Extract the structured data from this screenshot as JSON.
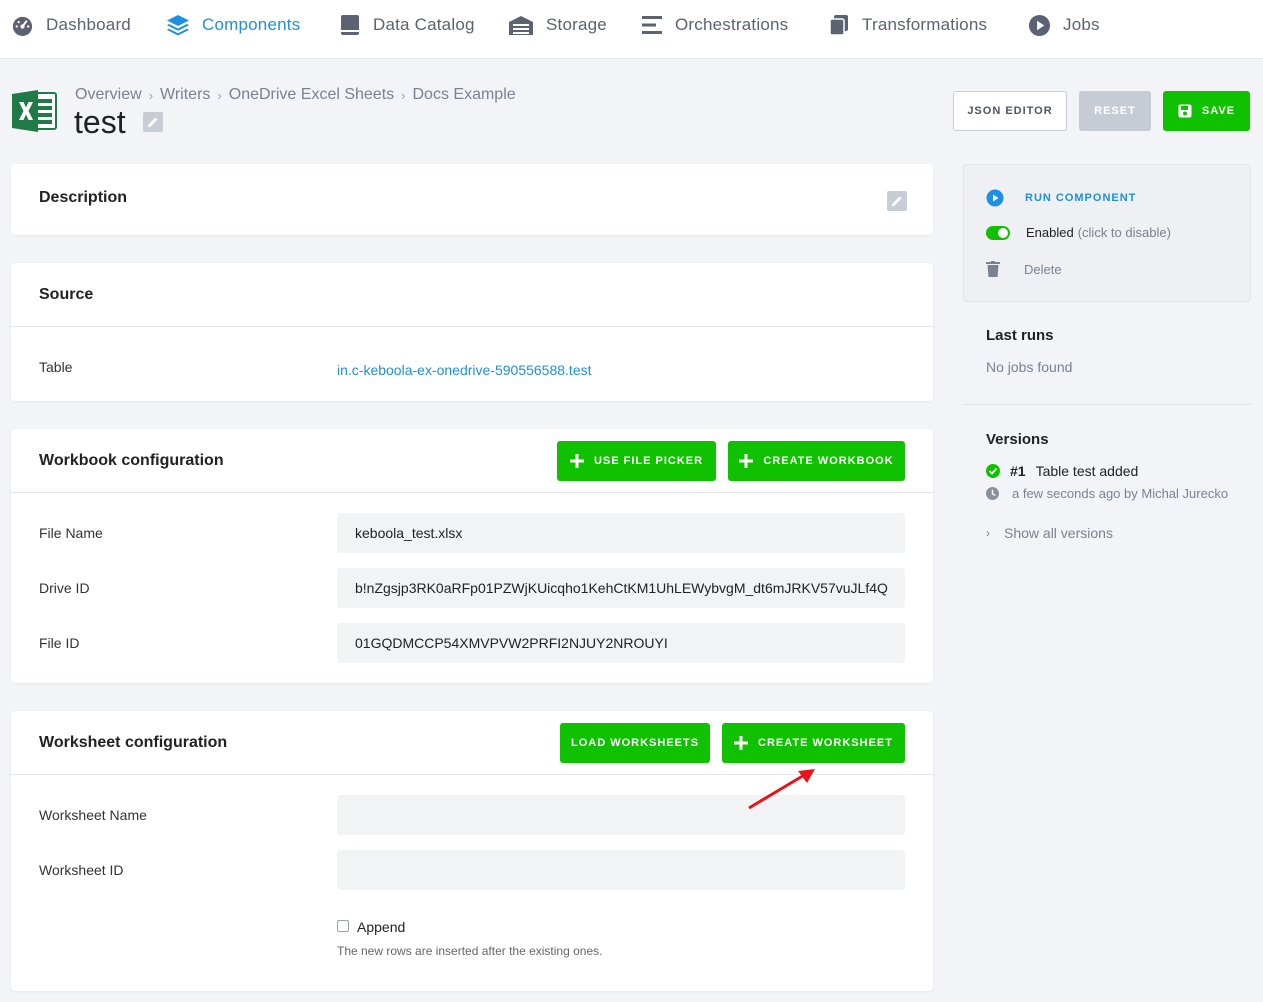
{
  "nav": {
    "dashboard": "Dashboard",
    "components": "Components",
    "data_catalog": "Data Catalog",
    "storage": "Storage",
    "orchestrations": "Orchestrations",
    "transformations": "Transformations",
    "jobs": "Jobs"
  },
  "breadcrumb": [
    "Overview",
    "Writers",
    "OneDrive Excel Sheets",
    "Docs Example"
  ],
  "page_title": "test",
  "toolbar": {
    "json_editor": "JSON EDITOR",
    "reset": "RESET",
    "save": "SAVE"
  },
  "description": {
    "title": "Description"
  },
  "source": {
    "title": "Source",
    "table_label": "Table",
    "table_value": "in.c-keboola-ex-onedrive-590556588.test"
  },
  "workbook": {
    "title": "Workbook configuration",
    "use_file_picker": "USE FILE PICKER",
    "create_workbook": "CREATE WORKBOOK",
    "file_name_label": "File Name",
    "file_name_value": "keboola_test.xlsx",
    "drive_id_label": "Drive ID",
    "drive_id_value": "b!nZgsjp3RK0aRFp01PZWjKUicqho1KehCtKM1UhLEWybvgM_dt6mJRKV57vuJLf4Q",
    "file_id_label": "File ID",
    "file_id_value": "01GQDMCCP54XMVPVW2PRFI2NJUY2NROUYI"
  },
  "worksheet": {
    "title": "Worksheet configuration",
    "load_worksheets": "LOAD WORKSHEETS",
    "create_worksheet": "CREATE WORKSHEET",
    "name_label": "Worksheet Name",
    "name_value": "",
    "id_label": "Worksheet ID",
    "id_value": "",
    "append_label": "Append",
    "append_help": "The new rows are inserted after the existing ones."
  },
  "sidebar": {
    "run_component": "RUN COMPONENT",
    "enabled": "Enabled",
    "enabled_hint": "(click to disable)",
    "delete": "Delete",
    "last_runs_title": "Last runs",
    "last_runs_empty": "No jobs found",
    "versions_title": "Versions",
    "version_number": "#1",
    "version_desc": "Table test added",
    "version_meta": "a few seconds ago by Michal Jurecko",
    "show_all_versions": "Show all versions"
  },
  "colors": {
    "accent_blue": "#1e8fe1",
    "green": "#10c100",
    "annotation_arrow": "#e8141b"
  }
}
